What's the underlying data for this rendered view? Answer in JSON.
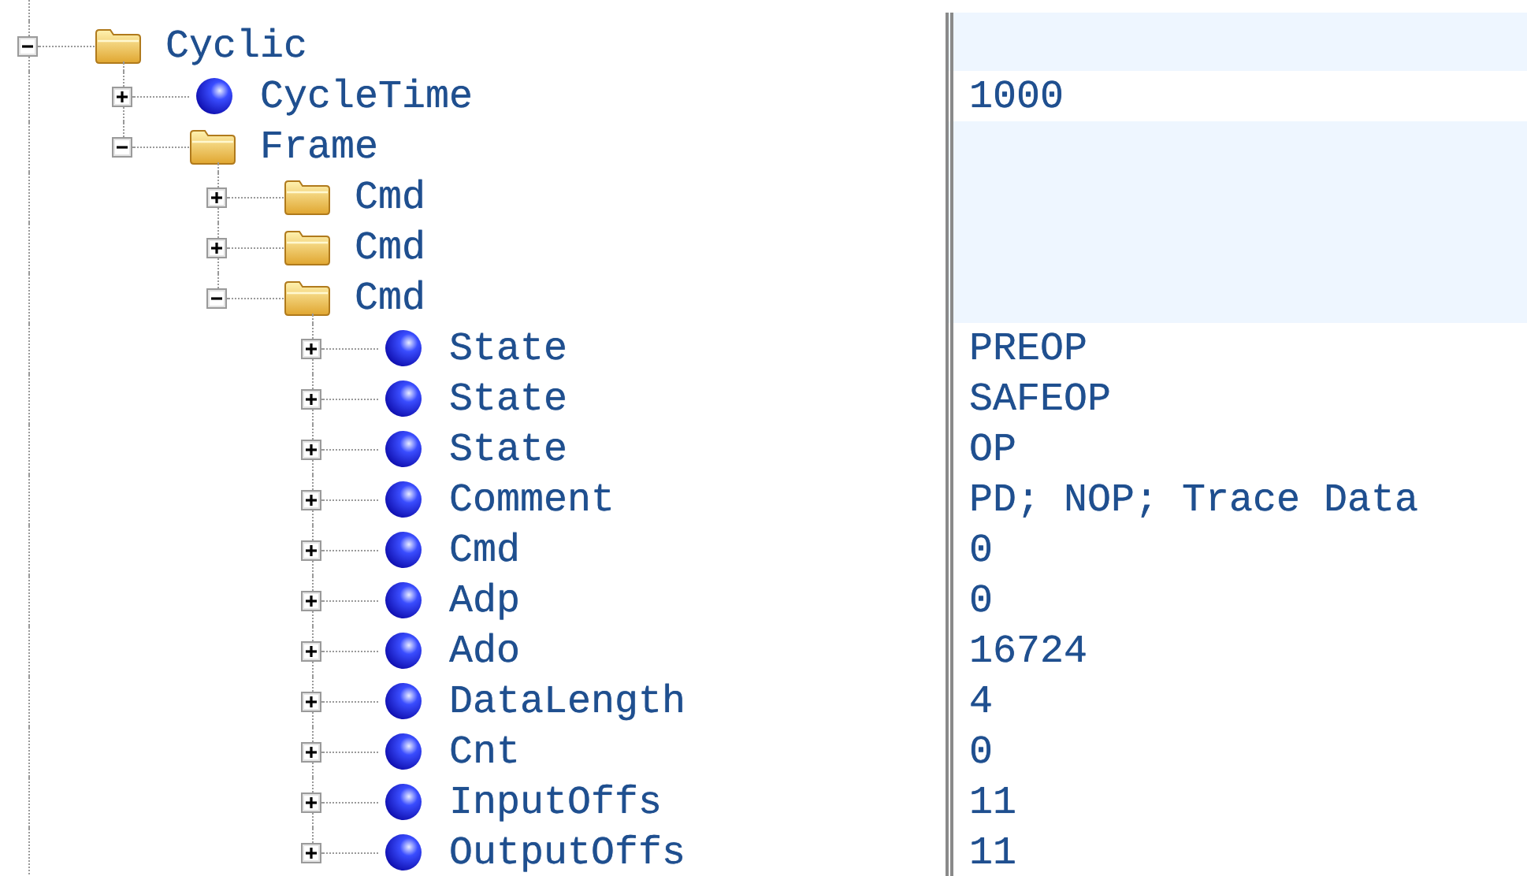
{
  "tree": [
    {
      "kind": "folder",
      "label": "Cyclic",
      "expanded": true,
      "children": [
        {
          "kind": "variable",
          "label": "CycleTime",
          "expanded": false,
          "value": "1000"
        },
        {
          "kind": "folder",
          "label": "Frame",
          "expanded": true,
          "children": [
            {
              "kind": "folder",
              "label": "Cmd",
              "expanded": false
            },
            {
              "kind": "folder",
              "label": "Cmd",
              "expanded": false
            },
            {
              "kind": "folder",
              "label": "Cmd",
              "expanded": true,
              "children": [
                {
                  "kind": "variable",
                  "label": "State",
                  "expanded": false,
                  "value": "PREOP"
                },
                {
                  "kind": "variable",
                  "label": "State",
                  "expanded": false,
                  "value": "SAFEOP"
                },
                {
                  "kind": "variable",
                  "label": "State",
                  "expanded": false,
                  "value": "OP"
                },
                {
                  "kind": "variable",
                  "label": "Comment",
                  "expanded": false,
                  "value": "PD; NOP; Trace Data"
                },
                {
                  "kind": "variable",
                  "label": "Cmd",
                  "expanded": false,
                  "value": "0"
                },
                {
                  "kind": "variable",
                  "label": "Adp",
                  "expanded": false,
                  "value": "0"
                },
                {
                  "kind": "variable",
                  "label": "Ado",
                  "expanded": false,
                  "value": "16724"
                },
                {
                  "kind": "variable",
                  "label": "DataLength",
                  "expanded": false,
                  "value": "4"
                },
                {
                  "kind": "variable",
                  "label": "Cnt",
                  "expanded": false,
                  "value": "0"
                },
                {
                  "kind": "variable",
                  "label": "InputOffs",
                  "expanded": false,
                  "value": "11"
                },
                {
                  "kind": "variable",
                  "label": "OutputOffs",
                  "expanded": false,
                  "value": "11"
                }
              ]
            }
          ]
        }
      ]
    }
  ]
}
